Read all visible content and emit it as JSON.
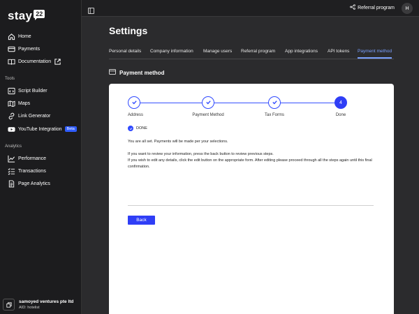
{
  "brand": {
    "logo_text": "stay",
    "logo_badge": "22"
  },
  "sidebar": {
    "items": [
      {
        "label": "Home",
        "icon": "home-icon"
      },
      {
        "label": "Payments",
        "icon": "card-icon"
      },
      {
        "label": "Documentation",
        "icon": "book-icon",
        "external_icon": "external-link-icon"
      }
    ],
    "tools_label": "Tools",
    "tools": [
      {
        "label": "Script Builder",
        "icon": "code-icon"
      },
      {
        "label": "Maps",
        "icon": "map-icon"
      },
      {
        "label": "Link Generator",
        "icon": "link-icon"
      },
      {
        "label": "YouTube Integration",
        "icon": "youtube-icon",
        "badge": "Beta"
      }
    ],
    "analytics_label": "Analytics",
    "analytics": [
      {
        "label": "Performance",
        "icon": "chart-line-icon"
      },
      {
        "label": "Transactions",
        "icon": "list-check-icon"
      },
      {
        "label": "Page Analytics",
        "icon": "document-icon"
      }
    ],
    "footer": {
      "company": "samoyed ventures pte ltd",
      "aid": "AID: hotelist"
    }
  },
  "topbar": {
    "referral_label": "Referral program",
    "avatar_initial": "H"
  },
  "page": {
    "title": "Settings",
    "tabs": [
      "Personal details",
      "Company information",
      "Manage users",
      "Referral program",
      "App integrations",
      "API tokens",
      "Payment method"
    ],
    "active_tab": "Payment method",
    "section_title": "Payment method"
  },
  "stepper": {
    "steps": [
      {
        "label": "Address",
        "state": "complete"
      },
      {
        "label": "Payment Method",
        "state": "complete"
      },
      {
        "label": "Tax Forms",
        "state": "complete"
      },
      {
        "label": "Done",
        "state": "current",
        "number": "4"
      }
    ]
  },
  "content": {
    "done_label": "DONE",
    "line1": "You are all set. Payments will be made per your selections.",
    "line2": "If you want to review your information, press the back button to review previous steps.",
    "line3": "If you wish to edit any details, click the edit button on the appropriate form. After editing please proceed through all the steps again until this final confirmation.",
    "back_label": "Back"
  },
  "colors": {
    "accent": "#2f3ef6",
    "active_tab": "#7aa0ff",
    "sidebar_bg": "#1c1c1e",
    "main_bg": "#2b2b2d"
  }
}
